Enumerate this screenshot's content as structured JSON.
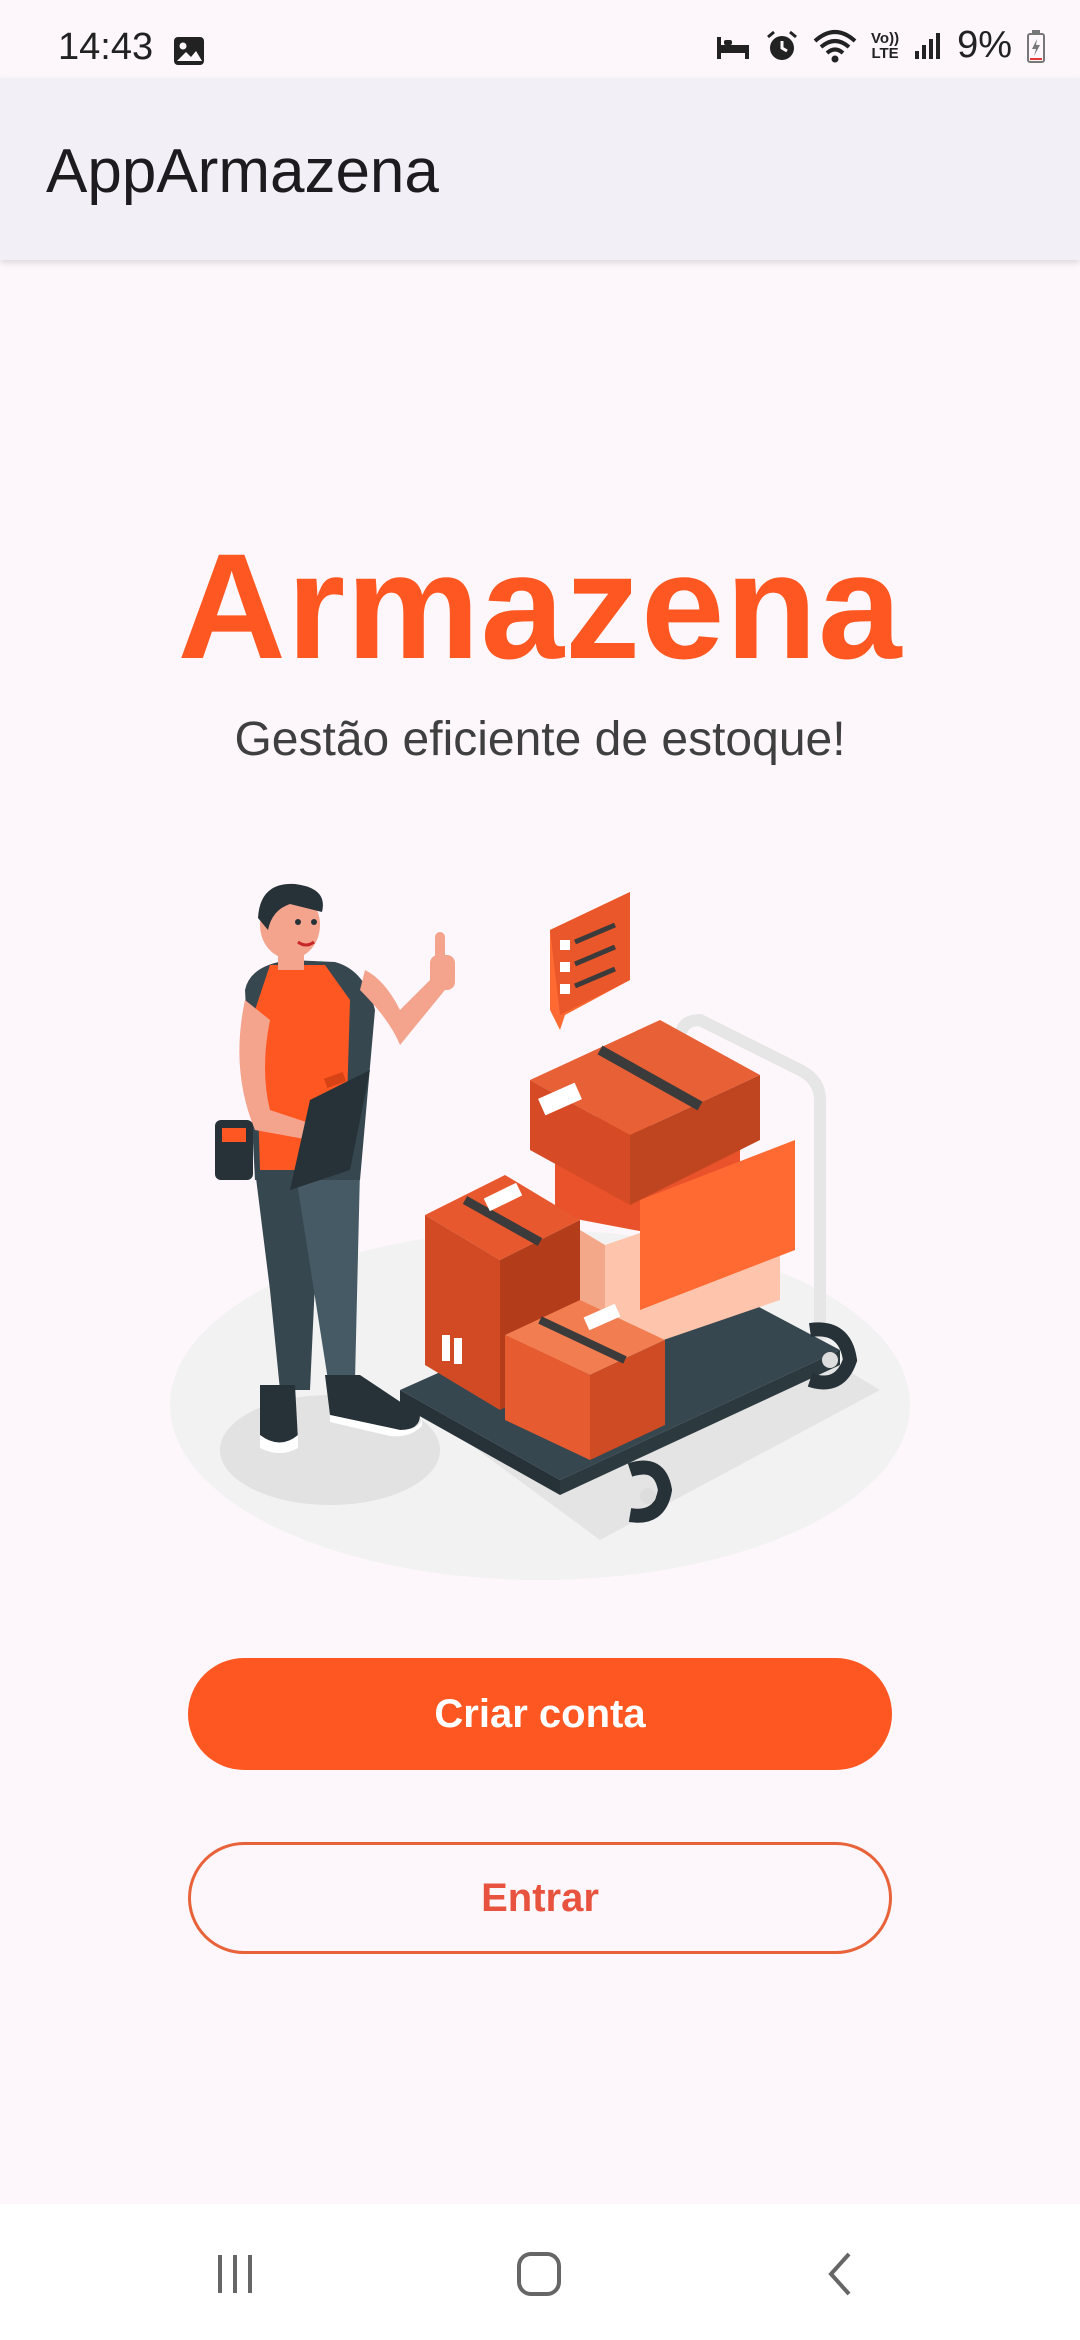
{
  "status_bar": {
    "time": "14:43",
    "battery": "9%",
    "icons": [
      "gallery-icon",
      "sleep-icon",
      "alarm-icon",
      "wifi-icon",
      "volte-icon",
      "signal-icon",
      "battery-icon"
    ],
    "volte_label_top": "Vo))",
    "volte_label_bottom": "LTE"
  },
  "app_bar": {
    "title": "AppArmazena"
  },
  "hero": {
    "title": "Armazena",
    "subtitle": "Gestão eficiente de estoque!",
    "illustration": "warehouse-worker-with-boxes-illustration"
  },
  "actions": {
    "create_account": "Criar conta",
    "sign_in": "Entrar"
  },
  "nav_bar": {
    "buttons": [
      "recent-apps-icon",
      "home-icon",
      "back-icon"
    ]
  },
  "colors": {
    "accent": "#fe5722",
    "background": "#fdf7fb",
    "app_bar": "#f2eff6",
    "outline_text": "#e8533f"
  }
}
